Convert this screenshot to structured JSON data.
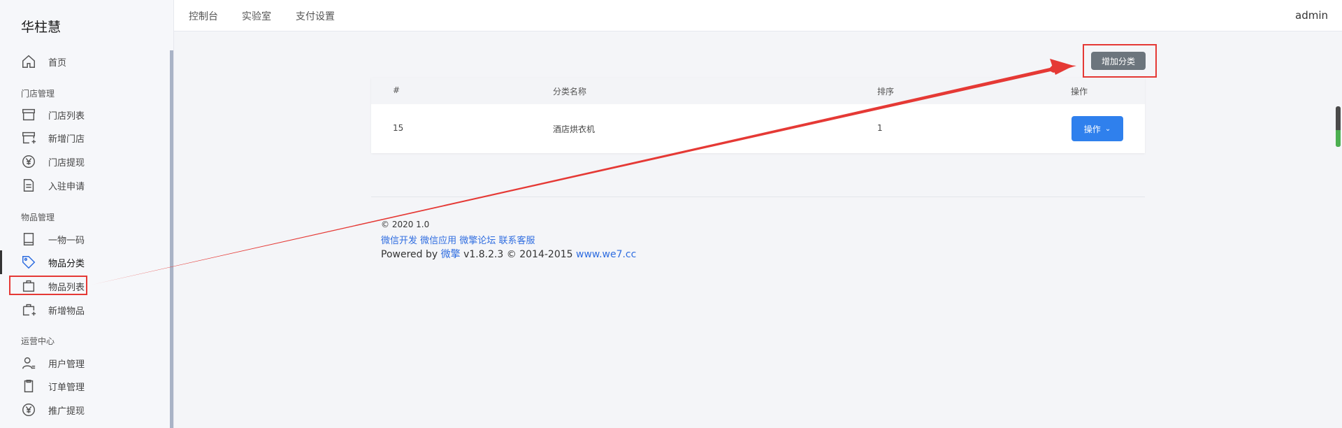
{
  "brand": "华柱慧",
  "sidebar": {
    "home": {
      "label": "首页",
      "icon": "home-icon"
    },
    "groups": [
      {
        "label": "门店管理",
        "items": [
          {
            "label": "门店列表",
            "icon": "store-icon"
          },
          {
            "label": "新增门店",
            "icon": "store-add-icon"
          },
          {
            "label": "门店提现",
            "icon": "yen-icon"
          },
          {
            "label": "入驻申请",
            "icon": "document-icon"
          }
        ]
      },
      {
        "label": "物品管理",
        "items": [
          {
            "label": "一物一码",
            "icon": "book-icon"
          },
          {
            "label": "物品分类",
            "icon": "tag-icon",
            "active": true
          },
          {
            "label": "物品列表",
            "icon": "bag-icon"
          },
          {
            "label": "新增物品",
            "icon": "bag-add-icon"
          }
        ]
      },
      {
        "label": "运营中心",
        "items": [
          {
            "label": "用户管理",
            "icon": "user-icon"
          },
          {
            "label": "订单管理",
            "icon": "clipboard-icon"
          },
          {
            "label": "推广提现",
            "icon": "yen-icon"
          }
        ]
      }
    ]
  },
  "topbar": {
    "nav": [
      "控制台",
      "实验室",
      "支付设置"
    ],
    "user": "admin"
  },
  "actions": {
    "add_category": "增加分类"
  },
  "table": {
    "headers": [
      "#",
      "分类名称",
      "排序",
      "操作"
    ],
    "rows": [
      {
        "id": "15",
        "name": "酒店烘衣机",
        "sort": "1",
        "action": "操作"
      }
    ]
  },
  "footer": {
    "copyright": "© 2020 1.0",
    "links": [
      "微信开发",
      "微信应用",
      "微擎论坛",
      "联系客服"
    ],
    "powered_prefix": "Powered by",
    "powered_brand": "微擎",
    "powered_version": "v1.8.2.3 © 2014-2015",
    "powered_site": "www.we7.cc"
  },
  "colors": {
    "primary": "#2f80ed",
    "annotation": "#e53935",
    "secondary_button": "#6c757d"
  }
}
